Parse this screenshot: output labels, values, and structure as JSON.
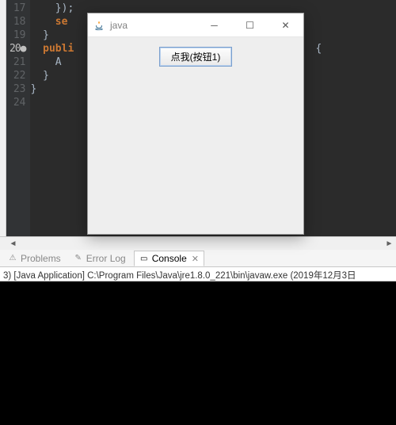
{
  "editor": {
    "lines": [
      {
        "num": "17",
        "frag": [
          {
            "t": "    });",
            "cls": ""
          }
        ]
      },
      {
        "num": "18",
        "frag": [
          {
            "t": "    ",
            "cls": ""
          },
          {
            "t": "se",
            "cls": "kw"
          }
        ]
      },
      {
        "num": "19",
        "frag": [
          {
            "t": "  }",
            "cls": "br"
          }
        ]
      },
      {
        "num": "20",
        "bp": true,
        "frag": [
          {
            "t": "  ",
            "cls": ""
          },
          {
            "t": "publi",
            "cls": "kw"
          },
          {
            "t": "                                       {",
            "cls": "br"
          }
        ]
      },
      {
        "num": "21",
        "frag": [
          {
            "t": "    A",
            "cls": ""
          }
        ]
      },
      {
        "num": "22",
        "frag": [
          {
            "t": "  }",
            "cls": "br"
          }
        ]
      },
      {
        "num": "23",
        "frag": [
          {
            "t": "}",
            "cls": "br"
          }
        ]
      },
      {
        "num": "24",
        "frag": [
          {
            "t": "",
            "cls": ""
          }
        ]
      }
    ]
  },
  "tabs": {
    "problems": "Problems",
    "errorlog": "Error Log",
    "console": "Console"
  },
  "info": "3) [Java Application] C:\\Program Files\\Java\\jre1.8.0_221\\bin\\javaw.exe (2019年12月3日",
  "jwin": {
    "title": "java",
    "button": "点我(按钮1)"
  }
}
